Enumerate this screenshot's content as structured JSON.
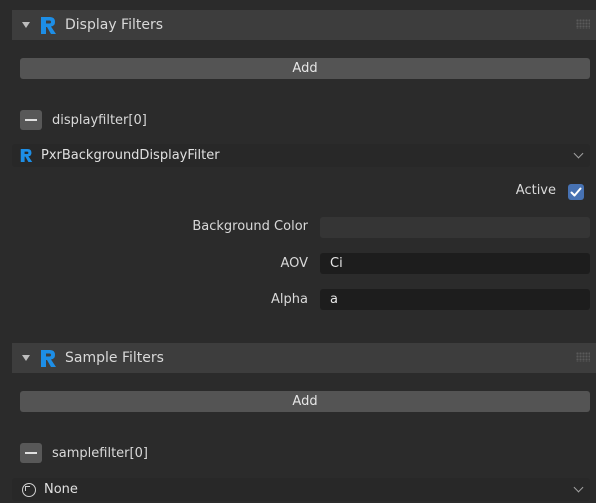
{
  "display_filters": {
    "header_title": "Display Filters",
    "add_label": "Add",
    "item_label": "displayfilter[0]",
    "filter_type": "PxrBackgroundDisplayFilter",
    "active_label": "Active",
    "active_checked": true,
    "background_color_label": "Background Color",
    "aov_label": "AOV",
    "aov_value": "Ci",
    "alpha_label": "Alpha",
    "alpha_value": "a"
  },
  "sample_filters": {
    "header_title": "Sample Filters",
    "add_label": "Add",
    "item_label": "samplefilter[0]",
    "filter_type": "None"
  },
  "colors": {
    "renderman_blue": "#1d8ee6",
    "checkbox_accent": "#4772b3",
    "panel_bg": "#2b2b2b",
    "header_bg": "#3d3d3d"
  },
  "icons": {
    "panel_logo": "renderman-logo-icon",
    "collapse": "chevron-down-icon",
    "remove": "minus-icon",
    "dropdown": "chevron-down-icon",
    "none_type": "circle-icon"
  }
}
